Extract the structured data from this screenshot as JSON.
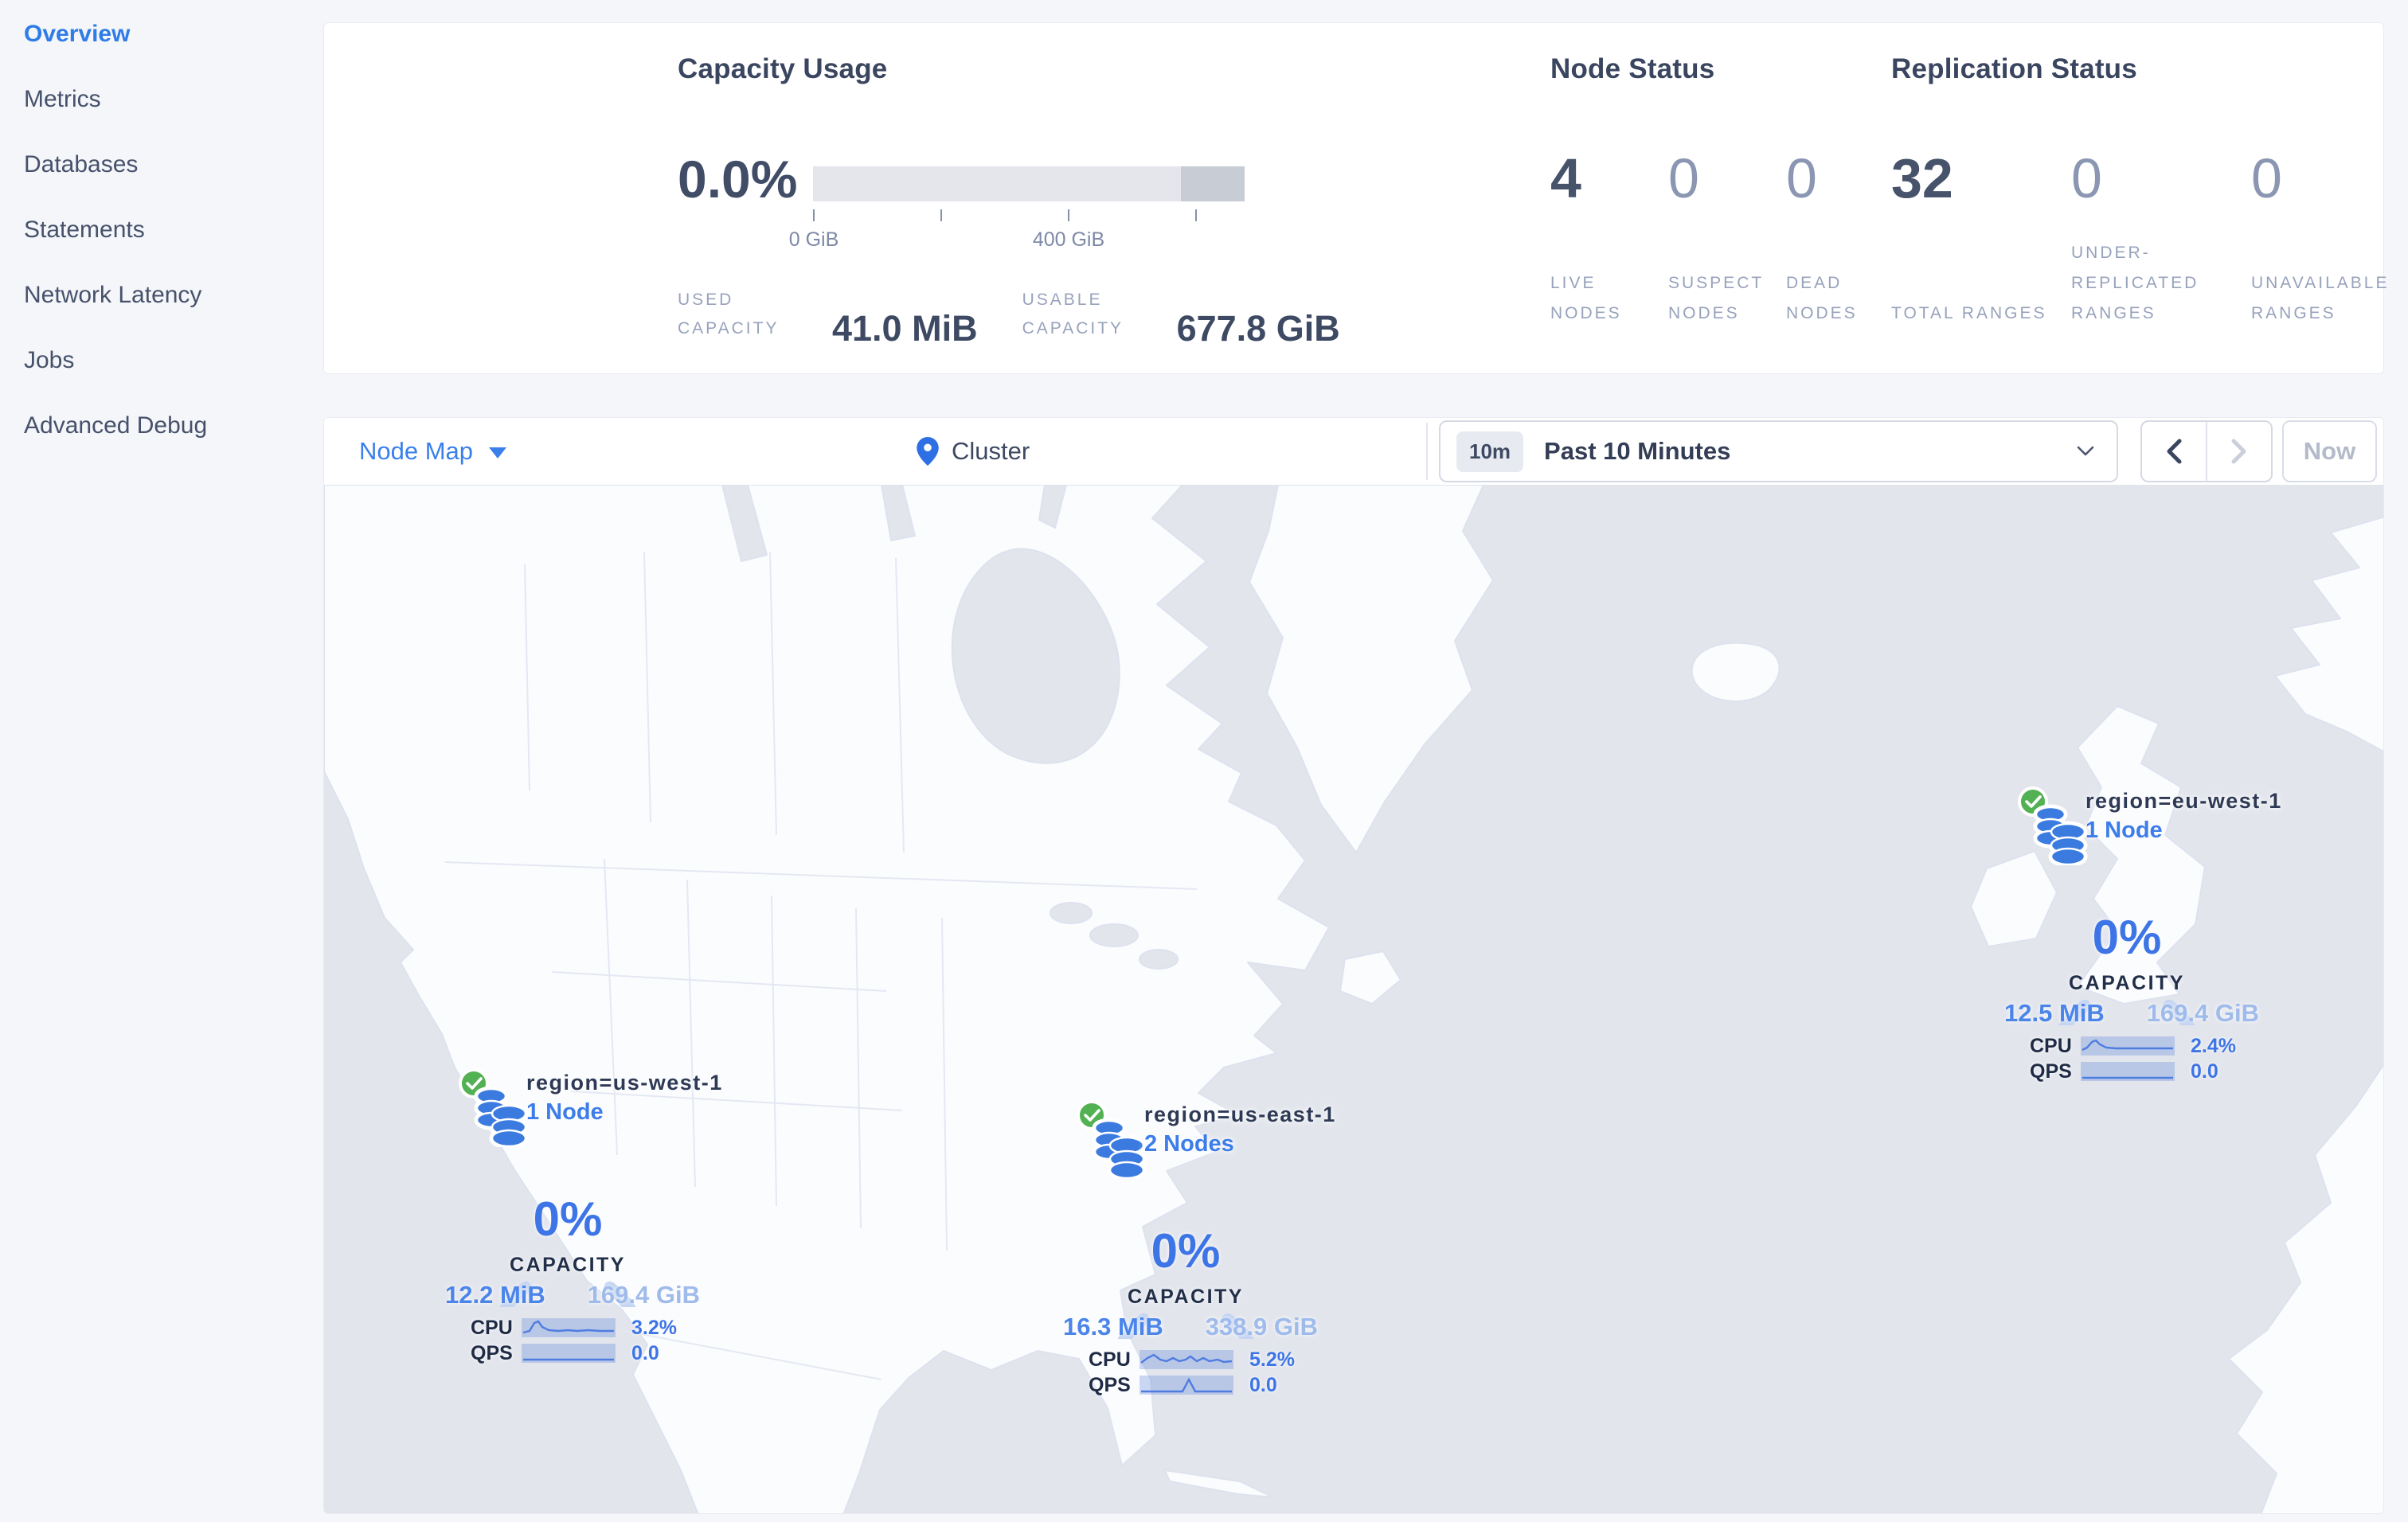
{
  "colors": {
    "accent_blue": "#2f7ce8",
    "marker_blue": "#3d74e6",
    "gauge_arc": "#c3d3f1",
    "ocean": "#e2e5ec",
    "land": "#fbfcfe",
    "page_bg": "#f4f6f9",
    "healthy_green": "#52b152"
  },
  "sidebar": {
    "items": [
      {
        "label": "Overview",
        "active": true
      },
      {
        "label": "Metrics",
        "active": false
      },
      {
        "label": "Databases",
        "active": false
      },
      {
        "label": "Statements",
        "active": false
      },
      {
        "label": "Network Latency",
        "active": false
      },
      {
        "label": "Jobs",
        "active": false
      },
      {
        "label": "Advanced Debug",
        "active": false
      }
    ]
  },
  "summary": {
    "capacity": {
      "title": "Capacity Usage",
      "percent": "0.0%",
      "tick_labels": [
        "0 GiB",
        "400 GiB"
      ],
      "stats": [
        {
          "label": "USED CAPACITY",
          "value": "41.0 MiB"
        },
        {
          "label": "USABLE CAPACITY",
          "value": "677.8 GiB"
        }
      ]
    },
    "nodes": {
      "title": "Node Status",
      "stats": [
        {
          "value": "4",
          "label": "LIVE NODES"
        },
        {
          "value": "0",
          "label": "SUSPECT NODES"
        },
        {
          "value": "0",
          "label": "DEAD NODES"
        }
      ]
    },
    "replication": {
      "title": "Replication Status",
      "stats": [
        {
          "value": "32",
          "label": "TOTAL RANGES"
        },
        {
          "value": "0",
          "label": "UNDER-REPLICATED RANGES"
        },
        {
          "value": "0",
          "label": "UNAVAILABLE RANGES"
        }
      ]
    }
  },
  "toolbar": {
    "view_label": "Node Map",
    "breadcrumb": "Cluster",
    "time_badge": "10m",
    "time_range": "Past 10 Minutes",
    "now_label": "Now"
  },
  "map": {
    "regions": [
      {
        "name": "region=us-west-1",
        "nodes": "1 Node",
        "percent": "0%",
        "capacity_label": "CAPACITY",
        "used": "12.2 MiB",
        "usable": "169.4 GiB",
        "cpu_label": "CPU",
        "cpu_value": "3.2%",
        "qps_label": "QPS",
        "qps_value": "0.0"
      },
      {
        "name": "region=us-east-1",
        "nodes": "2 Nodes",
        "percent": "0%",
        "capacity_label": "CAPACITY",
        "used": "16.3 MiB",
        "usable": "338.9 GiB",
        "cpu_label": "CPU",
        "cpu_value": "5.2%",
        "qps_label": "QPS",
        "qps_value": "0.0"
      },
      {
        "name": "region=eu-west-1",
        "nodes": "1 Node",
        "percent": "0%",
        "capacity_label": "CAPACITY",
        "used": "12.5 MiB",
        "usable": "169.4 GiB",
        "cpu_label": "CPU",
        "cpu_value": "2.4%",
        "qps_label": "QPS",
        "qps_value": "0.0"
      }
    ]
  }
}
